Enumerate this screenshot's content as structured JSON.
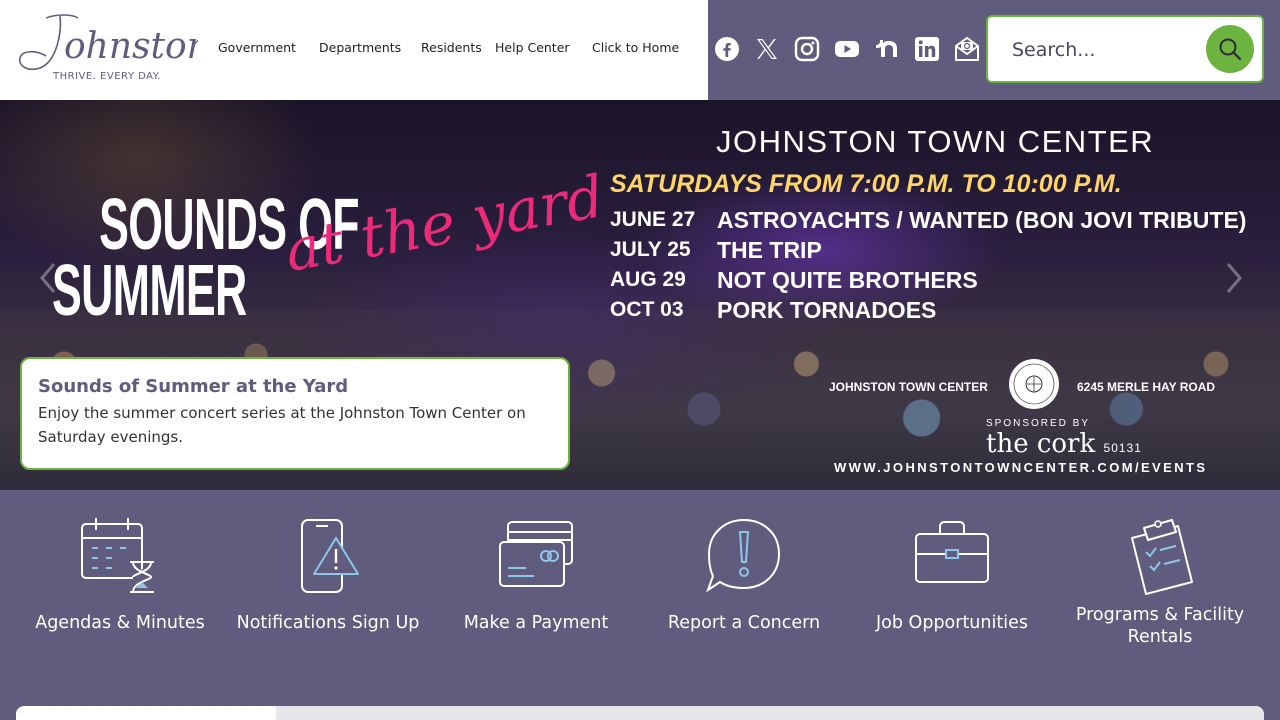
{
  "logo": {
    "name": "Johnston",
    "tagline": "THRIVE. EVERY DAY."
  },
  "nav": {
    "items": [
      {
        "label": "Government"
      },
      {
        "label": "Departments"
      },
      {
        "label": "Residents"
      },
      {
        "label": "Help Center"
      },
      {
        "label": "Click to Home"
      }
    ]
  },
  "social": {
    "icons": [
      "facebook-icon",
      "x-twitter-icon",
      "instagram-icon",
      "youtube-icon",
      "nextdoor-icon",
      "linkedin-icon",
      "email-newsletter-icon"
    ]
  },
  "search": {
    "placeholder": "Search..."
  },
  "hero": {
    "title_lines": "SOUNDS OF SUMMER",
    "script": "at the yard",
    "venue": "JOHNSTON TOWN CENTER",
    "schedule": "SATURDAYS FROM 7:00 P.M. TO 10:00 P.M.",
    "events": [
      {
        "date": "JUNE 27",
        "band": "ASTROYACHTS / WANTED (BON JOVI TRIBUTE)"
      },
      {
        "date": "JULY 25",
        "band": "THE TRIP"
      },
      {
        "date": "AUG 29",
        "band": "NOT QUITE BROTHERS"
      },
      {
        "date": "OCT 03",
        "band": "PORK TORNADOES"
      }
    ],
    "location_left": "JOHNSTON TOWN CENTER",
    "location_right": "6245 MERLE HAY ROAD",
    "sponsored_by": "SPONSORED BY",
    "sponsor": "the cork",
    "sponsor_zip": "50131",
    "website": "WWW.JOHNSTONTOWNCENTER.COM/EVENTS",
    "caption_title": "Sounds of Summer at the Yard",
    "caption_text": "Enjoy the summer concert series at the Johnston Town Center on Saturday evenings."
  },
  "quick_links": [
    {
      "label": "Agendas & Minutes",
      "icon": "calendar-hourglass-icon"
    },
    {
      "label": "Notifications Sign Up",
      "icon": "phone-alert-icon"
    },
    {
      "label": "Make a Payment",
      "icon": "credit-card-icon"
    },
    {
      "label": "Report a Concern",
      "icon": "exclamation-bubble-icon"
    },
    {
      "label": "Job Opportunities",
      "icon": "briefcase-icon"
    },
    {
      "label": "Programs & Facility Rentals",
      "icon": "clipboard-icon"
    }
  ],
  "colors": {
    "brand_purple": "#5f5c7e",
    "accent_green": "#6db33f",
    "highlight_yellow": "#fdd56a",
    "script_pink": "#ec2a79",
    "icon_blue": "#8fc6ea"
  }
}
